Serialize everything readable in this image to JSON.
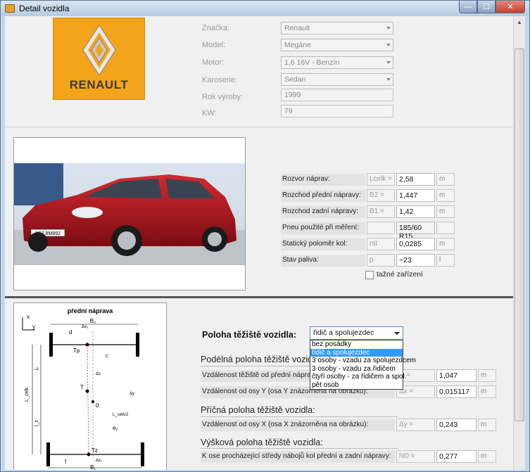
{
  "window": {
    "title": "Detail vozidla",
    "buttons": {
      "minimize": "—",
      "maximize": "☐",
      "close": "✕"
    }
  },
  "logo": {
    "brand_text": "RENAULT"
  },
  "vehicle": {
    "fields": [
      {
        "label": "Značka:",
        "value": "Renault",
        "kind": "combo"
      },
      {
        "label": "Model:",
        "value": "Megáne",
        "kind": "combo"
      },
      {
        "label": "Motor:",
        "value": "1,6 16V - Benzín",
        "kind": "combo"
      },
      {
        "label": "Karoserie:",
        "value": "Sedan",
        "kind": "combo"
      },
      {
        "label": "Rok výroby:",
        "value": "1999",
        "kind": "readonly"
      },
      {
        "label": "KW:",
        "value": "79",
        "kind": "readonly"
      }
    ]
  },
  "photo": {
    "plate": "6S2 8M892"
  },
  "dimensions": {
    "rows": [
      {
        "label": "Rozvor náprav:",
        "symbol": "Lcelk =",
        "value": "2,58",
        "unit": "m"
      },
      {
        "label": "Rozchod přední nápravy:",
        "symbol": "B2 =",
        "value": "1,447",
        "unit": "m"
      },
      {
        "label": "Rozchod zadní nápravy:",
        "symbol": "B1 =",
        "value": "1,42",
        "unit": "m"
      },
      {
        "label": "Pneu použité při měření:",
        "symbol": "",
        "value": "185/60 R15",
        "unit": ""
      },
      {
        "label": "Statický poloměr kol:",
        "symbol": "rst",
        "value": "0,0285",
        "unit": "m"
      },
      {
        "label": "Stav paliva:",
        "symbol": "p",
        "value": "~23",
        "unit": "l"
      }
    ],
    "tow_hitch_label": "tažné zařízení",
    "tow_hitch_checked": false
  },
  "diagram": {
    "title": "přední náprava",
    "labels": {
      "b2": "B₂",
      "b1": "B₁",
      "d": "d",
      "c": "c",
      "e": "eᵧ",
      "f": "f",
      "tp": "Tp",
      "tz": "Tz",
      "t": "T",
      "zero": "0",
      "lp": "lₚ",
      "lz": "l_z",
      "lcelk": "L_celk",
      "lcelk_half": "L_celk/2",
      "dx1": "Δx₁",
      "dx2": "Δx₂",
      "dx": "Δx",
      "dy": "Δy",
      "axis_x": "x",
      "axis_y": "y"
    }
  },
  "cog": {
    "heading": "Poloha těžiště vozidla:",
    "selected": "řidič a spolujezdec",
    "options": [
      "bez posádky",
      "řidič a spolujezdec",
      "3 osoby - vzadu za spolujezdcem",
      "3 osoby - vzadu za řidičem",
      "čtyři osoby - za řidičem a spol.",
      "pět osob"
    ],
    "selected_index": 1,
    "longitudinal": {
      "title": "Podélná poloha těžiště vozidla:",
      "rows": [
        {
          "label": "Vzdálenost těžiště od přední nápravy",
          "symbol": "lp =",
          "value": "1,047",
          "unit": "m"
        },
        {
          "label": "Vzdálenost od osy Y (osa Y znázorněna na obrázku):",
          "symbol": "Δx =",
          "value": "0,015117",
          "unit": "m"
        }
      ]
    },
    "lateral": {
      "title": "Příčná poloha těžiště vozidla:",
      "rows": [
        {
          "label": "Vzdálenost od osy X (osa X znázorněna na obrázku):",
          "symbol": "Δy =",
          "value": "0,243",
          "unit": "m"
        }
      ]
    },
    "vertical": {
      "title": "Výšková poloha těžiště vozidla:",
      "rows": [
        {
          "label": "K ose procházející středy nábojů kol přední a zadní nápravy:",
          "symbol": "ht0 =",
          "value": "0,277",
          "unit": "m"
        }
      ]
    }
  },
  "colors": {
    "logo_bg": "#f4a41a",
    "selection": "#3399ff",
    "car": "#b0141c"
  }
}
